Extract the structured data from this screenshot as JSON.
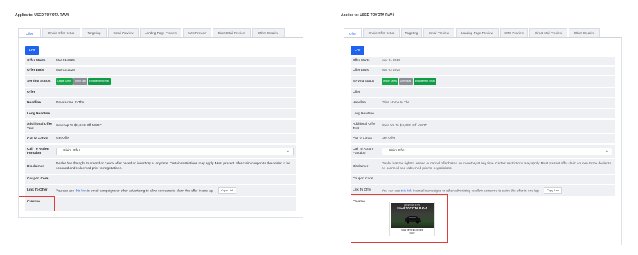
{
  "left": {
    "applies_to": "Applies to: USED TOYOTA RAV4",
    "tabs": [
      {
        "label": "Offer",
        "width": 33
      },
      {
        "label": "Onsite Offer Setup",
        "width": 55
      },
      {
        "label": "Targeting",
        "width": 36
      },
      {
        "label": "Email Preview",
        "width": 44
      },
      {
        "label": "Landing Page Preview",
        "width": 60
      },
      {
        "label": "SMS Preview",
        "width": 41
      },
      {
        "label": "Direct Mail Preview",
        "width": 55
      },
      {
        "label": "Other Creative",
        "width": 47
      }
    ],
    "edit_label": "Edit",
    "fields": {
      "offer_starts_label": "Offer Starts",
      "offer_starts": "Mar 01 2025",
      "offer_ends_label": "Offer Ends",
      "offer_ends": "Mar 02 2025",
      "serving_status_label": "Serving Status",
      "badges": [
        "Onsite Offers",
        "Direct Mail",
        "Engagement Email"
      ],
      "offer_label": "Offer",
      "headline_label": "Headline",
      "headline": "Drive Home In The",
      "long_headline_label": "Long Headline",
      "additional_label": "Additional Offer Text",
      "additional": "Save Up To $X,XXX Off MSRP",
      "cta_label": "Call to Action",
      "cta": "Get Offer",
      "cta_function_label": "Call To Action Function",
      "cta_function": "Claim Offer",
      "disclaimer_label": "Disclaimer",
      "disclaimer": "Dealer has the right to amend or cancel offer based on inventory at any time. Certain restrictions may apply. Must present offer claim coupon to the dealer to be scanned and redeemed prior to negotiations.",
      "coupon_label": "Coupon Code",
      "link_label": "Link To Offer",
      "link_pre": "You can use ",
      "link_word": "this link",
      "link_post": " in email campaigns or other advertising to allow someone to claim this offer in one tap",
      "copy_label": "Copy Link",
      "creative_label": "Creative"
    }
  },
  "right": {
    "applies_to": "Applies to: USED TOYOTA RAV4",
    "tabs": [
      {
        "label": "Offer",
        "width": 26
      },
      {
        "label": "Onsite Offer Setup",
        "width": 53
      },
      {
        "label": "Targeting",
        "width": 30
      },
      {
        "label": "Email Preview",
        "width": 45
      },
      {
        "label": "Landing Page Preview",
        "width": 62
      },
      {
        "label": "SMS Preview",
        "width": 40
      },
      {
        "label": "Direct Mail Preview",
        "width": 55
      },
      {
        "label": "Other Creative",
        "width": 45
      }
    ],
    "edit_label": "Edit",
    "fields": {
      "offer_starts_label": "Offer Starts",
      "offer_starts": "Mar 01 2025",
      "offer_ends_label": "Offer Ends",
      "offer_ends": "Mar 02 2025",
      "serving_status_label": "Serving Status",
      "badges": [
        "Onsite Offers",
        "Direct Mail",
        "Engagement Email"
      ],
      "offer_label": "Offer",
      "headline_label": "Headline",
      "headline": "Drive Home In The",
      "long_headline_label": "Long Headline",
      "additional_label": "Additional Offer Text",
      "additional": "Save Up To $X,XXX Off MSRP",
      "cta_label": "Call to Action",
      "cta": "Get Offer",
      "cta_function_label": "Call To Action Function",
      "cta_function": "Claim Offer",
      "disclaimer_label": "Disclaimer",
      "disclaimer": "Dealer has the right to amend or cancel offer based on inventory at any time. Certain restrictions may apply. Must present offer claim coupon to the dealer to be scanned and redeemed prior to negotiations.",
      "coupon_label": "Coupon Code",
      "link_label": "Link To Offer",
      "link_pre": "You can use ",
      "link_word": "this link",
      "link_post": " in email campaigns or other advertising to allow someone to claim this offer in one tap",
      "copy_label": "Copy Link",
      "creative_label": "Creative",
      "creative_kicker": "DRIVE HOME IN THE",
      "creative_title": "Used TOYOTA RAV4",
      "creative_cap1": "SAVE UP TO $X,XXX OFF",
      "creative_cap2": "MSRP"
    }
  },
  "colors": {
    "accent": "#1e63f0",
    "highlight": "#e23b3b",
    "badge_green": "#1aa64a",
    "badge_gray": "#8a8f96"
  }
}
